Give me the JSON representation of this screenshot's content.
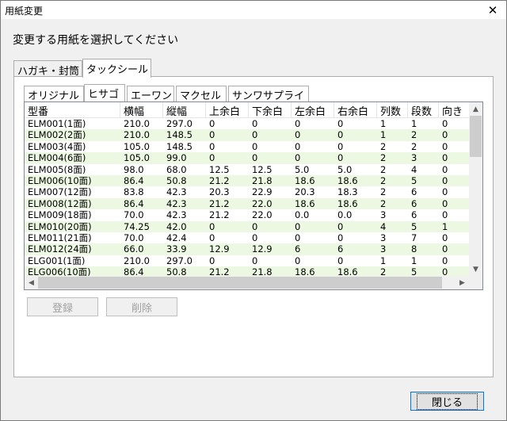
{
  "window": {
    "title": "用紙変更",
    "close_glyph": "✕"
  },
  "prompt": "変更する用紙を選択してください",
  "outer_tabs": [
    {
      "label": "ハガキ・封筒",
      "active": false
    },
    {
      "label": "タックシール",
      "active": true
    }
  ],
  "inner_tabs": [
    {
      "label": "オリジナル",
      "active": false
    },
    {
      "label": "ヒサゴ",
      "active": true
    },
    {
      "label": "エーワン",
      "active": false
    },
    {
      "label": "マクセル",
      "active": false
    },
    {
      "label": "サンワサプライ",
      "active": false
    }
  ],
  "table": {
    "columns": [
      "型番",
      "横幅",
      "縦幅",
      "上余白",
      "下余白",
      "左余白",
      "右余白",
      "列数",
      "段数",
      "向き"
    ],
    "rows": [
      [
        "ELM001(1面)",
        "210.0",
        "297.0",
        "0",
        "0",
        "0",
        "0",
        "1",
        "1",
        "0"
      ],
      [
        "ELM002(2面)",
        "210.0",
        "148.5",
        "0",
        "0",
        "0",
        "0",
        "1",
        "2",
        "0"
      ],
      [
        "ELM003(4面)",
        "105.0",
        "148.5",
        "0",
        "0",
        "0",
        "0",
        "2",
        "2",
        "0"
      ],
      [
        "ELM004(6面)",
        "105.0",
        "99.0",
        "0",
        "0",
        "0",
        "0",
        "2",
        "3",
        "0"
      ],
      [
        "ELM005(8面)",
        "98.0",
        "68.0",
        "12.5",
        "12.5",
        "5.0",
        "5.0",
        "2",
        "4",
        "0"
      ],
      [
        "ELM006(10面)",
        "86.4",
        "50.8",
        "21.2",
        "21.8",
        "18.6",
        "18.6",
        "2",
        "5",
        "0"
      ],
      [
        "ELM007(12面)",
        "83.8",
        "42.3",
        "20.3",
        "22.9",
        "20.3",
        "18.3",
        "2",
        "6",
        "0"
      ],
      [
        "ELM008(12面)",
        "86.4",
        "42.3",
        "21.2",
        "22.0",
        "18.6",
        "18.6",
        "2",
        "6",
        "0"
      ],
      [
        "ELM009(18面)",
        "70.0",
        "42.3",
        "21.2",
        "22.0",
        "0.0",
        "0.0",
        "3",
        "6",
        "0"
      ],
      [
        "ELM010(20面)",
        "74.25",
        "42.0",
        "0",
        "0",
        "0",
        "0",
        "4",
        "5",
        "1"
      ],
      [
        "ELM011(21面)",
        "70.0",
        "42.4",
        "0",
        "0",
        "0",
        "0",
        "3",
        "7",
        "0"
      ],
      [
        "ELM012(24面)",
        "66.0",
        "33.9",
        "12.9",
        "12.9",
        "6",
        "6",
        "3",
        "8",
        "0"
      ],
      [
        "ELG001(1面)",
        "210.0",
        "297.0",
        "0",
        "0",
        "0",
        "0",
        "1",
        "1",
        "0"
      ],
      [
        "ELG006(10面)",
        "86.4",
        "50.8",
        "21.2",
        "21.8",
        "18.6",
        "18.6",
        "2",
        "5",
        "0"
      ]
    ]
  },
  "scroll": {
    "up": "▲",
    "down": "▼",
    "left": "◀",
    "right": "▶"
  },
  "buttons": {
    "register": "登録",
    "delete": "削除",
    "close": "閉じる"
  }
}
